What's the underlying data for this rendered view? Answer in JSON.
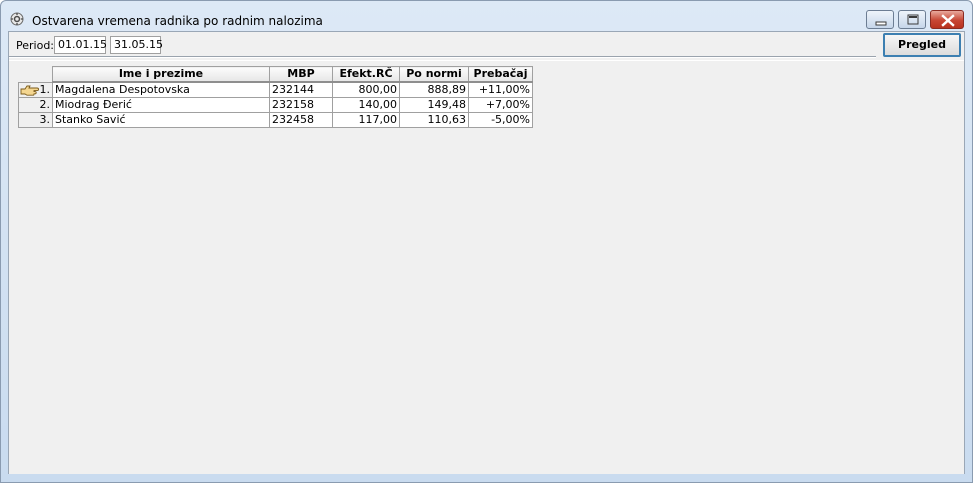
{
  "window": {
    "title": "Ostvarena vremena radnika po radnim nalozima"
  },
  "toolbar": {
    "period_label": "Period:",
    "date_from": "01.01.15",
    "date_to": "31.05.15",
    "pregled_label": "Pregled"
  },
  "grid": {
    "columns": [
      "Ime i prezime",
      "MBP",
      "Efekt.RČ",
      "Po normi",
      "Prebačaj"
    ],
    "rows": [
      {
        "num": "1.",
        "name": "Magdalena Despotovska",
        "mbp": "232144",
        "efekt": "800,00",
        "norma": "888,89",
        "prebacaj": "+11,00%"
      },
      {
        "num": "2.",
        "name": "Miodrag Đerić",
        "mbp": "232158",
        "efekt": "140,00",
        "norma": "149,48",
        "prebacaj": "+7,00%"
      },
      {
        "num": "3.",
        "name": "Stanko Savić",
        "mbp": "232458",
        "efekt": "117,00",
        "norma": "110,63",
        "prebacaj": "-5,00%"
      }
    ]
  },
  "icons": {
    "app": "gear-icon",
    "row_pointer": "hand-pointer-icon"
  }
}
